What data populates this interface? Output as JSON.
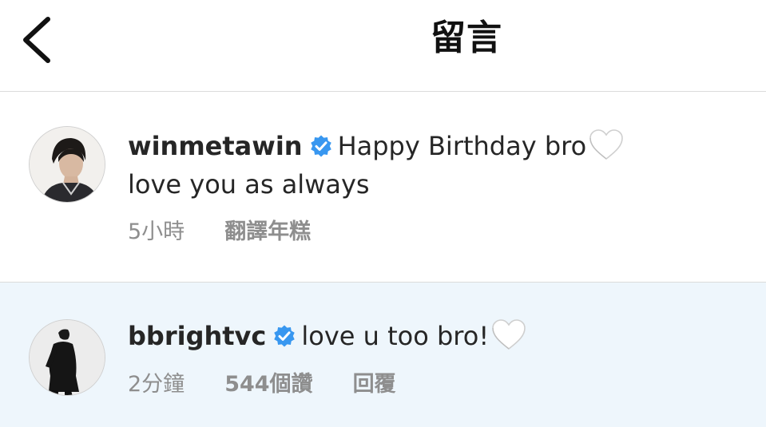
{
  "header": {
    "title": "留言"
  },
  "comments": [
    {
      "username": "winmetawin",
      "verified": true,
      "text_line1": "Happy Birthday bro",
      "text_line2": "love you as always",
      "time": "5小時",
      "translate_label": "翻譯年糕"
    },
    {
      "username": "bbrightvc",
      "verified": true,
      "text_line1": "love u too bro!",
      "time": "2分鐘",
      "likes_label": "544個讚",
      "reply_label": "回覆"
    }
  ],
  "colors": {
    "verified_badge": "#3897f0",
    "highlight_bg": "#eef6fc",
    "meta_text": "#8e8e8e",
    "heart_fill": "#ffffff"
  },
  "icons": {
    "back": "chevron-left-icon",
    "verified": "verified-badge-icon",
    "heart": "white-heart-emoji-icon"
  }
}
